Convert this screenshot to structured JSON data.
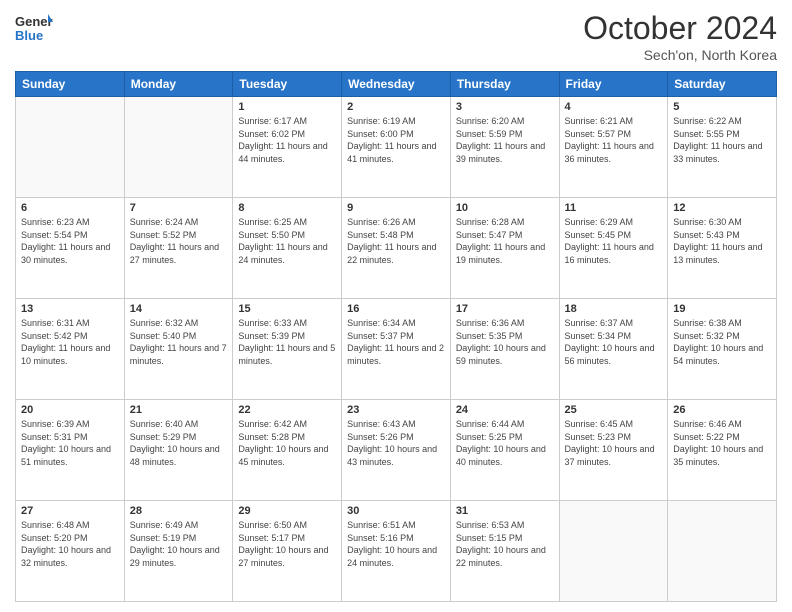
{
  "logo": {
    "text_general": "General",
    "text_blue": "Blue"
  },
  "header": {
    "month": "October 2024",
    "location": "Sech'on, North Korea"
  },
  "weekdays": [
    "Sunday",
    "Monday",
    "Tuesday",
    "Wednesday",
    "Thursday",
    "Friday",
    "Saturday"
  ],
  "weeks": [
    [
      {
        "day": "",
        "info": ""
      },
      {
        "day": "",
        "info": ""
      },
      {
        "day": "1",
        "info": "Sunrise: 6:17 AM\nSunset: 6:02 PM\nDaylight: 11 hours and 44 minutes."
      },
      {
        "day": "2",
        "info": "Sunrise: 6:19 AM\nSunset: 6:00 PM\nDaylight: 11 hours and 41 minutes."
      },
      {
        "day": "3",
        "info": "Sunrise: 6:20 AM\nSunset: 5:59 PM\nDaylight: 11 hours and 39 minutes."
      },
      {
        "day": "4",
        "info": "Sunrise: 6:21 AM\nSunset: 5:57 PM\nDaylight: 11 hours and 36 minutes."
      },
      {
        "day": "5",
        "info": "Sunrise: 6:22 AM\nSunset: 5:55 PM\nDaylight: 11 hours and 33 minutes."
      }
    ],
    [
      {
        "day": "6",
        "info": "Sunrise: 6:23 AM\nSunset: 5:54 PM\nDaylight: 11 hours and 30 minutes."
      },
      {
        "day": "7",
        "info": "Sunrise: 6:24 AM\nSunset: 5:52 PM\nDaylight: 11 hours and 27 minutes."
      },
      {
        "day": "8",
        "info": "Sunrise: 6:25 AM\nSunset: 5:50 PM\nDaylight: 11 hours and 24 minutes."
      },
      {
        "day": "9",
        "info": "Sunrise: 6:26 AM\nSunset: 5:48 PM\nDaylight: 11 hours and 22 minutes."
      },
      {
        "day": "10",
        "info": "Sunrise: 6:28 AM\nSunset: 5:47 PM\nDaylight: 11 hours and 19 minutes."
      },
      {
        "day": "11",
        "info": "Sunrise: 6:29 AM\nSunset: 5:45 PM\nDaylight: 11 hours and 16 minutes."
      },
      {
        "day": "12",
        "info": "Sunrise: 6:30 AM\nSunset: 5:43 PM\nDaylight: 11 hours and 13 minutes."
      }
    ],
    [
      {
        "day": "13",
        "info": "Sunrise: 6:31 AM\nSunset: 5:42 PM\nDaylight: 11 hours and 10 minutes."
      },
      {
        "day": "14",
        "info": "Sunrise: 6:32 AM\nSunset: 5:40 PM\nDaylight: 11 hours and 7 minutes."
      },
      {
        "day": "15",
        "info": "Sunrise: 6:33 AM\nSunset: 5:39 PM\nDaylight: 11 hours and 5 minutes."
      },
      {
        "day": "16",
        "info": "Sunrise: 6:34 AM\nSunset: 5:37 PM\nDaylight: 11 hours and 2 minutes."
      },
      {
        "day": "17",
        "info": "Sunrise: 6:36 AM\nSunset: 5:35 PM\nDaylight: 10 hours and 59 minutes."
      },
      {
        "day": "18",
        "info": "Sunrise: 6:37 AM\nSunset: 5:34 PM\nDaylight: 10 hours and 56 minutes."
      },
      {
        "day": "19",
        "info": "Sunrise: 6:38 AM\nSunset: 5:32 PM\nDaylight: 10 hours and 54 minutes."
      }
    ],
    [
      {
        "day": "20",
        "info": "Sunrise: 6:39 AM\nSunset: 5:31 PM\nDaylight: 10 hours and 51 minutes."
      },
      {
        "day": "21",
        "info": "Sunrise: 6:40 AM\nSunset: 5:29 PM\nDaylight: 10 hours and 48 minutes."
      },
      {
        "day": "22",
        "info": "Sunrise: 6:42 AM\nSunset: 5:28 PM\nDaylight: 10 hours and 45 minutes."
      },
      {
        "day": "23",
        "info": "Sunrise: 6:43 AM\nSunset: 5:26 PM\nDaylight: 10 hours and 43 minutes."
      },
      {
        "day": "24",
        "info": "Sunrise: 6:44 AM\nSunset: 5:25 PM\nDaylight: 10 hours and 40 minutes."
      },
      {
        "day": "25",
        "info": "Sunrise: 6:45 AM\nSunset: 5:23 PM\nDaylight: 10 hours and 37 minutes."
      },
      {
        "day": "26",
        "info": "Sunrise: 6:46 AM\nSunset: 5:22 PM\nDaylight: 10 hours and 35 minutes."
      }
    ],
    [
      {
        "day": "27",
        "info": "Sunrise: 6:48 AM\nSunset: 5:20 PM\nDaylight: 10 hours and 32 minutes."
      },
      {
        "day": "28",
        "info": "Sunrise: 6:49 AM\nSunset: 5:19 PM\nDaylight: 10 hours and 29 minutes."
      },
      {
        "day": "29",
        "info": "Sunrise: 6:50 AM\nSunset: 5:17 PM\nDaylight: 10 hours and 27 minutes."
      },
      {
        "day": "30",
        "info": "Sunrise: 6:51 AM\nSunset: 5:16 PM\nDaylight: 10 hours and 24 minutes."
      },
      {
        "day": "31",
        "info": "Sunrise: 6:53 AM\nSunset: 5:15 PM\nDaylight: 10 hours and 22 minutes."
      },
      {
        "day": "",
        "info": ""
      },
      {
        "day": "",
        "info": ""
      }
    ]
  ]
}
